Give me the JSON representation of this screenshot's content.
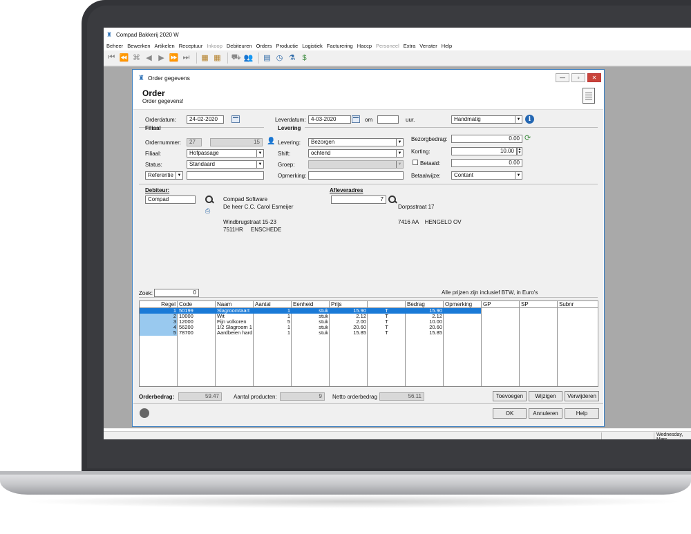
{
  "app": {
    "title": "Compad Bakkerij 2020 W",
    "menu": [
      "Beheer",
      "Bewerken",
      "Artikelen",
      "Receptuur",
      "Inkoop",
      "Debiteuren",
      "Orders",
      "Productie",
      "Logistiek",
      "Facturering",
      "Haccp",
      "Personeel",
      "Extra",
      "Venster",
      "Help"
    ],
    "disabled_menu": [
      "Inkoop",
      "Personeel"
    ],
    "status_date": "Wednesday, Marc"
  },
  "dialog": {
    "title": "Order gegevens",
    "heading": "Order",
    "subheading": "Order gegevens!",
    "orderdatum_label": "Orderdatum:",
    "orderdatum": "24-02-2020",
    "leverdatum_label": "Leverdatum:",
    "leverdatum": "4-03-2020",
    "om_label": "om",
    "uur_label": "uur.",
    "handmatig": "Handmatig",
    "filiaal_section": "Filiaal",
    "levering_section": "Levering",
    "ordernummer_label": "Ordernummer:",
    "ordernummer_a": "27",
    "ordernummer_b": "15",
    "filiaal_label": "Filiaal:",
    "filiaal": "Hofpassage",
    "status_label": "Status:",
    "status": "Standaard",
    "referentie": "Referentie",
    "levering_label": "Levering:",
    "levering": "Bezorgen",
    "shift_label": "Shift:",
    "shift": "ochtend",
    "groep_label": "Groep:",
    "opmerking_label": "Opmerking:",
    "bezorgbedrag_label": "Bezorgbedrag:",
    "bezorgbedrag": "0.00",
    "korting_label": "Korting:",
    "korting": "10.00",
    "betaald_label": "Betaald:",
    "betaald": "0.00",
    "betaalwijze_label": "Betaalwijze:",
    "betaalwijze": "Contant",
    "debiteur_label": "Debiteur:",
    "debiteur": "Compad",
    "debiteur_lines": [
      "Compad Software",
      "De heer C.C. Carol Esmeijer",
      "",
      "Windbrugstraat 15-23",
      "7511HR     ENSCHEDE"
    ],
    "afleveradres_label": "Afleveradres",
    "afleveradres_nr": "7",
    "afleveradres_lines": [
      "Dorpsstraat 17",
      "",
      "7416 AA    HENGELO OV"
    ],
    "zoek_label": "Zoek:",
    "zoek": "0",
    "prices_note": "Alle prijzen zijn inclusief BTW, in Euro's",
    "columns": [
      "Regel",
      "Code",
      "Naam",
      "Aantal",
      "Eenheid",
      "Prijs",
      "",
      "Bedrag",
      "Opmerking",
      "GP",
      "SP",
      "Subnr"
    ],
    "rows": [
      {
        "regel": "1",
        "code": "50199",
        "naam": "Slagroomtaart",
        "aantal": "1",
        "eenheid": "stuk",
        "prijs": "15.90",
        "t": "T",
        "bedrag": "15.90"
      },
      {
        "regel": "2",
        "code": "10000",
        "naam": "Wit",
        "aantal": "1",
        "eenheid": "stuk",
        "prijs": "2.12",
        "t": "T",
        "bedrag": "2.12"
      },
      {
        "regel": "3",
        "code": "12000",
        "naam": "Fijn volkoren",
        "aantal": "5",
        "eenheid": "stuk",
        "prijs": "2.00",
        "t": "T",
        "bedrag": "10.00"
      },
      {
        "regel": "4",
        "code": "56200",
        "naam": "1/2 Slagroom 1",
        "aantal": "1",
        "eenheid": "stuk",
        "prijs": "20.60",
        "t": "T",
        "bedrag": "20.60"
      },
      {
        "regel": "5",
        "code": "78700",
        "naam": "Aardbeien hard",
        "aantal": "1",
        "eenheid": "stuk",
        "prijs": "15.85",
        "t": "T",
        "bedrag": "15.85"
      }
    ],
    "orderbedrag_label": "Orderbedrag:",
    "orderbedrag": "59.47",
    "aantal_label": "Aantal producten:",
    "aantal": "9",
    "netto_label": "Netto orderbedrag",
    "netto": "56.11",
    "btn_toevoegen": "Toevoegen",
    "btn_wijzigen": "Wijzigen",
    "btn_verwijderen": "Verwijderen",
    "btn_ok": "OK",
    "btn_annuleren": "Annuleren",
    "btn_help": "Help"
  },
  "colors": {
    "selection": "#1a7ad7",
    "selection_light": "#99c9ef",
    "accent": "#2467b3"
  }
}
